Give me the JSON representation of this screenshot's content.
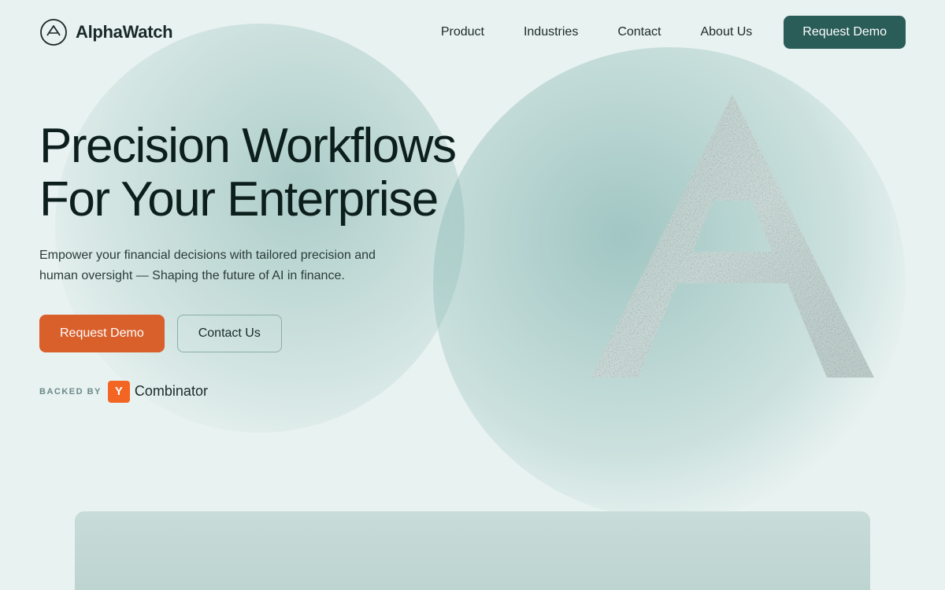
{
  "brand": {
    "logo_text": "AlphaWatch",
    "logo_icon_alt": "alphawatch-logo"
  },
  "nav": {
    "links": [
      {
        "label": "Product",
        "id": "nav-product"
      },
      {
        "label": "Industries",
        "id": "nav-industries"
      },
      {
        "label": "Contact",
        "id": "nav-contact"
      },
      {
        "label": "About Us",
        "id": "nav-about"
      }
    ],
    "cta_label": "Request Demo"
  },
  "hero": {
    "title_line1": "Precision Workflows",
    "title_line2": "For Your Enterprise",
    "subtitle": "Empower your financial decisions with tailored precision and human oversight — Shaping the future of AI in finance.",
    "btn_primary": "Request Demo",
    "btn_secondary": "Contact Us",
    "backed_by_label": "BACKED BY",
    "yc_letter": "Y",
    "yc_name": "Combinator"
  },
  "colors": {
    "bg": "#e8f2f0",
    "nav_cta": "#2a5c58",
    "btn_primary": "#d95f2b",
    "text_dark": "#0d1f1c",
    "text_mid": "#2a3c38"
  }
}
